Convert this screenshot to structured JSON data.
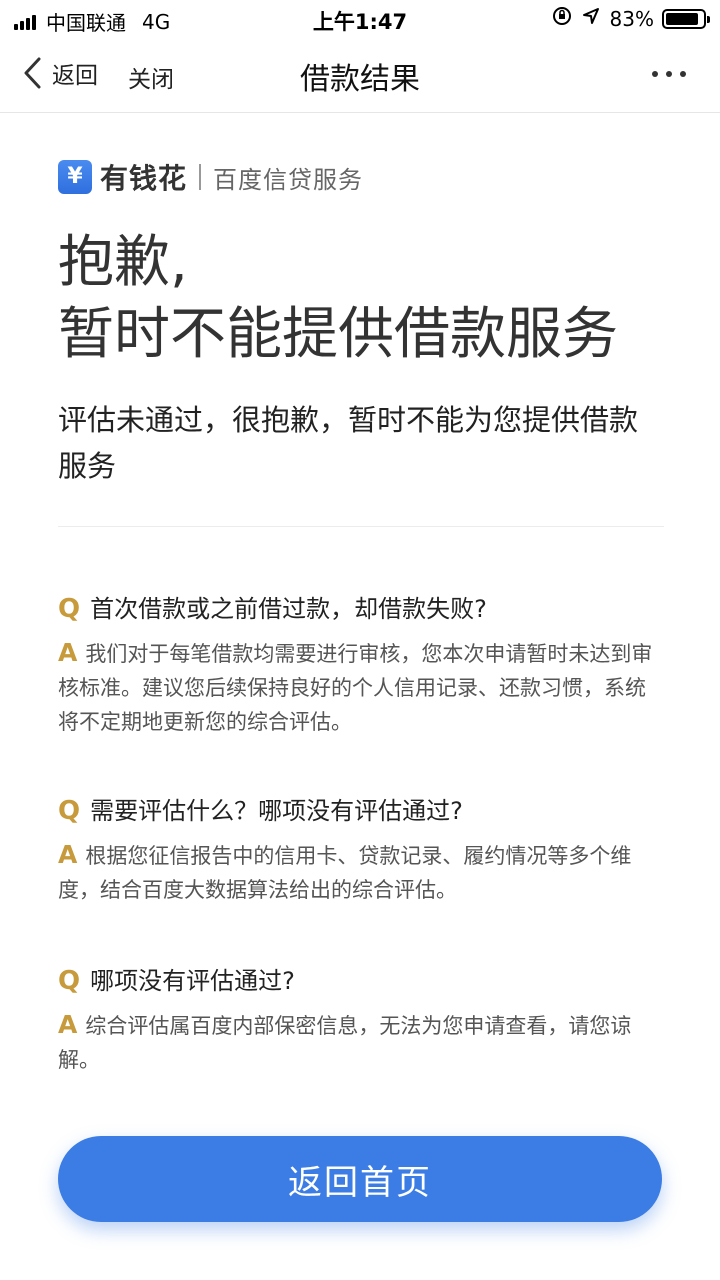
{
  "status_bar": {
    "carrier": "中国联通",
    "network": "4G",
    "time": "上午1:47",
    "battery": "83%"
  },
  "nav": {
    "back_label": "返回",
    "close_label": "关闭",
    "title": "借款结果"
  },
  "brand": {
    "logo_glyph": "¥",
    "name": "有钱花",
    "subtitle": "百度信贷服务"
  },
  "result": {
    "headline_line1": "抱歉,",
    "headline_line2": "暂时不能提供借款服务",
    "description": "评估未通过，很抱歉，暂时不能为您提供借款服务"
  },
  "faq": {
    "q_mark": "Q",
    "a_mark": "A",
    "items": [
      {
        "question": "首次借款或之前借过款，却借款失败?",
        "answer": "我们对于每笔借款均需要进行审核，您本次申请暂时未达到审核标准。建议您后续保持良好的个人信用记录、还款习惯，系统将不定期地更新您的综合评估。"
      },
      {
        "question": "需要评估什么？哪项没有评估通过?",
        "answer": "根据您征信报告中的信用卡、贷款记录、履约情况等多个维度，结合百度大数据算法给出的综合评估。"
      },
      {
        "question": "哪项没有评估通过?",
        "answer": "综合评估属百度内部保密信息，无法为您申请查看，请您谅解。"
      }
    ]
  },
  "primary_button": {
    "label": "返回首页"
  },
  "colors": {
    "accent": "#3b7de4",
    "qa_mark": "#c79a3c"
  }
}
